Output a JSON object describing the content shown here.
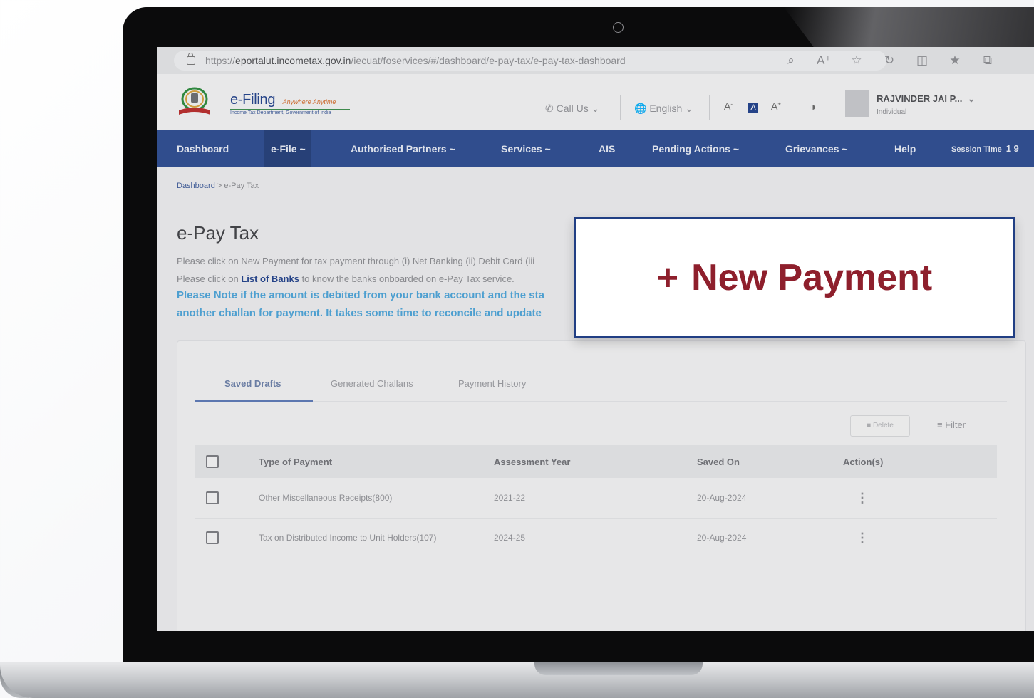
{
  "browser": {
    "url_prefix": "https://",
    "url_host": "eportalut.incometax.gov.in",
    "url_path": "/iecuat/foservices/#/dashboard/e-pay-tax/e-pay-tax-dashboard"
  },
  "header": {
    "brand_name": "e-Filing",
    "brand_tagline": "Anywhere Anytime",
    "brand_subtitle": "Income Tax Department, Government of India",
    "call_us": "Call Us",
    "language": "English",
    "font_decrease": "A",
    "font_normal": "A",
    "font_increase": "A",
    "user_name": "RAJVINDER JAI P...",
    "user_role": "Individual"
  },
  "nav": {
    "items": [
      {
        "label": "Dashboard"
      },
      {
        "label": "e-File ~"
      },
      {
        "label": "Authorised Partners ~"
      },
      {
        "label": "Services ~"
      },
      {
        "label": "AIS"
      },
      {
        "label": "Pending Actions ~"
      },
      {
        "label": "Grievances ~"
      },
      {
        "label": "Help"
      }
    ],
    "session_label": "Session Time",
    "session_value": "1 9"
  },
  "breadcrumb": {
    "root": "Dashboard",
    "separator": ">",
    "current": "e-Pay Tax"
  },
  "page": {
    "title": "e-Pay Tax",
    "info_line1": "Please click on New Payment for tax payment through (i) Net Banking (ii) Debit Card (iii",
    "info_line2_prefix": "Please click on ",
    "info_line2_link": "List of Banks",
    "info_line2_suffix": " to know the banks onboarded on e-Pay Tax service.",
    "note_line1": "Please Note if the amount is debited from your bank account and the sta",
    "note_line2": "another challan for payment. It takes some time to reconcile and update"
  },
  "tabs": [
    {
      "label": "Saved Drafts"
    },
    {
      "label": "Generated Challans"
    },
    {
      "label": "Payment History"
    }
  ],
  "actions": {
    "delete": "Delete",
    "filter": "Filter"
  },
  "table": {
    "headers": [
      "Type of Payment",
      "Assessment Year",
      "Saved On",
      "Action(s)"
    ],
    "rows": [
      {
        "type": "Other Miscellaneous Receipts(800)",
        "year": "2021-22",
        "saved_on": "20-Aug-2024"
      },
      {
        "type": "Tax on Distributed Income to Unit Holders(107)",
        "year": "2024-25",
        "saved_on": "20-Aug-2024"
      }
    ]
  },
  "callout": {
    "plus": "+",
    "label": "New Payment"
  },
  "colors": {
    "nav_bg": "#2b4a90",
    "callout_text": "#8e1f2c",
    "callout_border": "#213f84",
    "note_text": "#4aa3d8"
  }
}
